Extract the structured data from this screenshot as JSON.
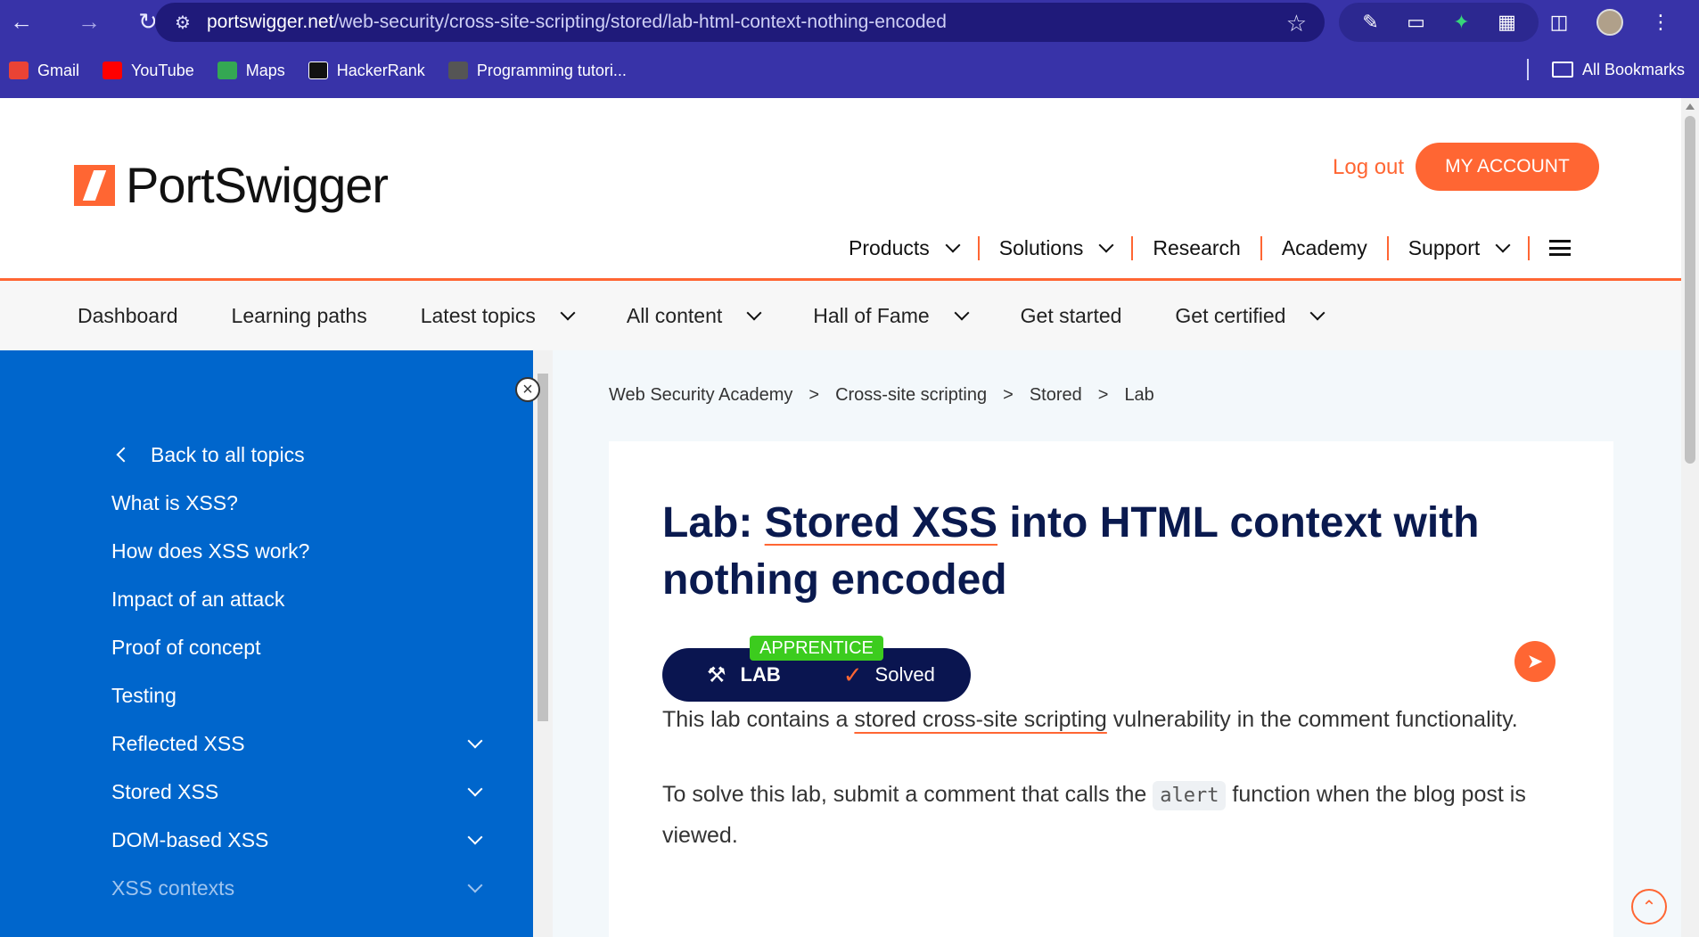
{
  "browser": {
    "url_host": "portswigger.net",
    "url_path": "/web-security/cross-site-scripting/stored/lab-html-context-nothing-encoded",
    "bookmarks": [
      "Gmail",
      "YouTube",
      "Maps",
      "HackerRank",
      "Programming tutori..."
    ],
    "all_bookmarks": "All Bookmarks"
  },
  "header": {
    "logo_text": "PortSwigger",
    "logout": "Log out",
    "my_account": "MY ACCOUNT",
    "nav": [
      "Products",
      "Solutions",
      "Research",
      "Academy",
      "Support"
    ]
  },
  "subnav": [
    "Dashboard",
    "Learning paths",
    "Latest topics",
    "All content",
    "Hall of Fame",
    "Get started",
    "Get certified"
  ],
  "sidebar": {
    "back": "Back to all topics",
    "items": [
      "What is XSS?",
      "How does XSS work?",
      "Impact of an attack",
      "Proof of concept",
      "Testing",
      "Reflected XSS",
      "Stored XSS",
      "DOM-based XSS",
      "XSS contexts"
    ]
  },
  "breadcrumb": [
    "Web Security Academy",
    "Cross-site scripting",
    "Stored",
    "Lab"
  ],
  "lab": {
    "title_prefix": "Lab: ",
    "title_link": "Stored XSS",
    "title_rest": " into HTML context with nothing encoded",
    "level": "APPRENTICE",
    "badge_label": "LAB",
    "status": "Solved",
    "p1_a": "This lab contains a ",
    "p1_link": "stored cross-site scripting",
    "p1_b": " vulnerability in the comment functionality.",
    "p2_a": "To solve this lab, submit a comment that calls the ",
    "p2_code": "alert",
    "p2_b": " function when the blog post is viewed."
  },
  "colors": {
    "accent": "#ff6633",
    "sidebar": "#0066cc",
    "navy": "#0a1550",
    "chrome": "#3833a8"
  }
}
